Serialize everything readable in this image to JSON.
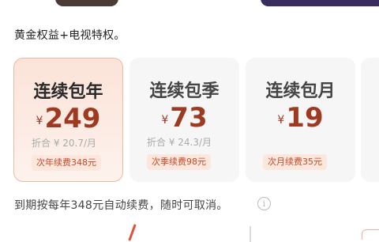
{
  "benefit_text": "黄金权益+电视特权。",
  "plans": [
    {
      "name": "连续包年",
      "currency": "¥",
      "price": "249",
      "per_month": "折合 ¥ 20.7/月",
      "renew_label": "次年续费348元",
      "selected": true
    },
    {
      "name": "连续包季",
      "currency": "¥",
      "price": "73",
      "per_month": "折合 ¥ 24.3/月",
      "renew_label": "次季续费98元",
      "selected": false
    },
    {
      "name": "连续包月",
      "currency": "¥",
      "price": "19",
      "per_month": "",
      "renew_label": "次月续费35元",
      "selected": false
    }
  ],
  "notice": "到期按每年348元自动续费，随时可取消。",
  "info_icon": "info-icon",
  "colors": {
    "price": "#9e3a22",
    "selected_border": "#f1b7a1",
    "badge_bg": "#fde7dd"
  }
}
